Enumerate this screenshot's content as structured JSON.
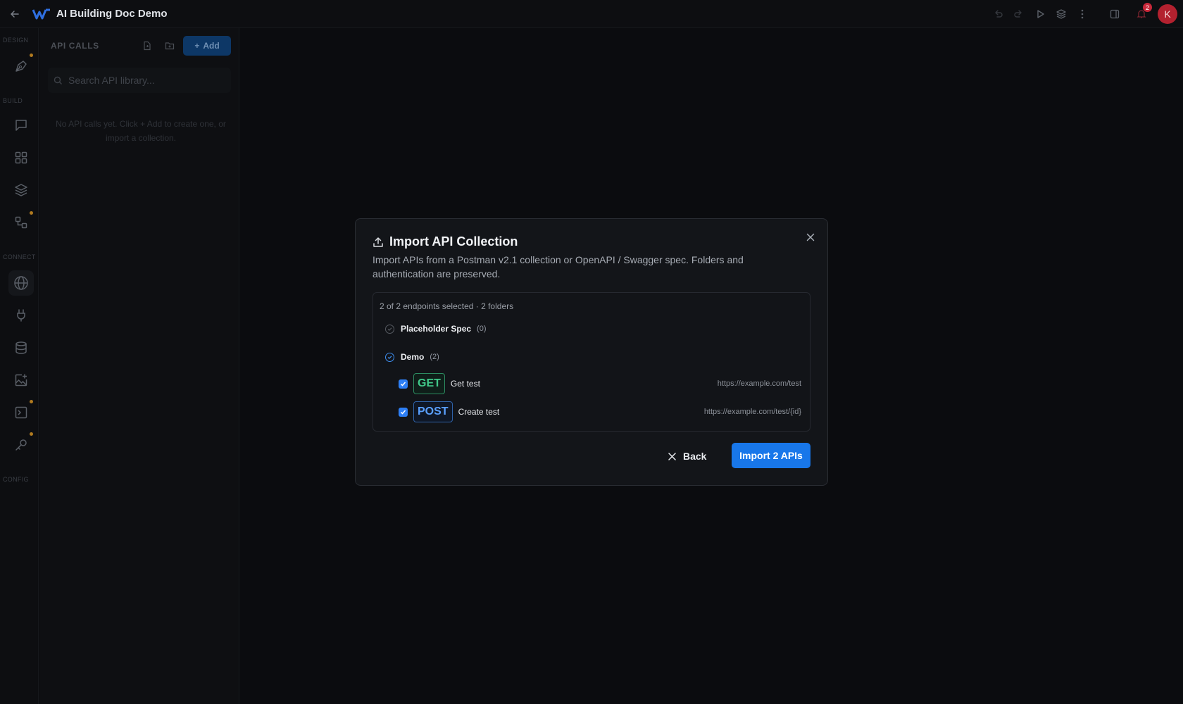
{
  "app": {
    "title": "AI Building Doc Demo",
    "notification_count": "2",
    "avatar_initial": "K"
  },
  "rail": {
    "sections": {
      "design": "DESIGN",
      "build": "BUILD",
      "connect": "CONNECT",
      "config": "CONFIG"
    }
  },
  "panel": {
    "title": "API CALLS",
    "add_label": "Add",
    "search_placeholder": "Search API library...",
    "empty_text": "No API calls yet. Click + Add to create one, or import a collection."
  },
  "modal": {
    "title": "Import API Collection",
    "description": "Import APIs from a Postman v2.1 collection or OpenAPI / Swagger spec. Folders and authentication are preserved.",
    "summary": "2 of 2 endpoints selected · 2 folders",
    "folders": [
      {
        "name": "Placeholder Spec",
        "count": "(0)",
        "selected": false
      },
      {
        "name": "Demo",
        "count": "(2)",
        "selected": true
      }
    ],
    "endpoints": [
      {
        "method": "GET",
        "name": "Get test",
        "url": "https://example.com/test",
        "checked": true
      },
      {
        "method": "POST",
        "name": "Create test",
        "url": "https://example.com/test/{id}",
        "checked": true
      }
    ],
    "back_label": "Back",
    "import_label": "Import 2 APIs"
  },
  "colors": {
    "accent": "#1877ea",
    "get": "#41c98a",
    "post": "#5aa0ff",
    "badge": "#c8283a"
  }
}
